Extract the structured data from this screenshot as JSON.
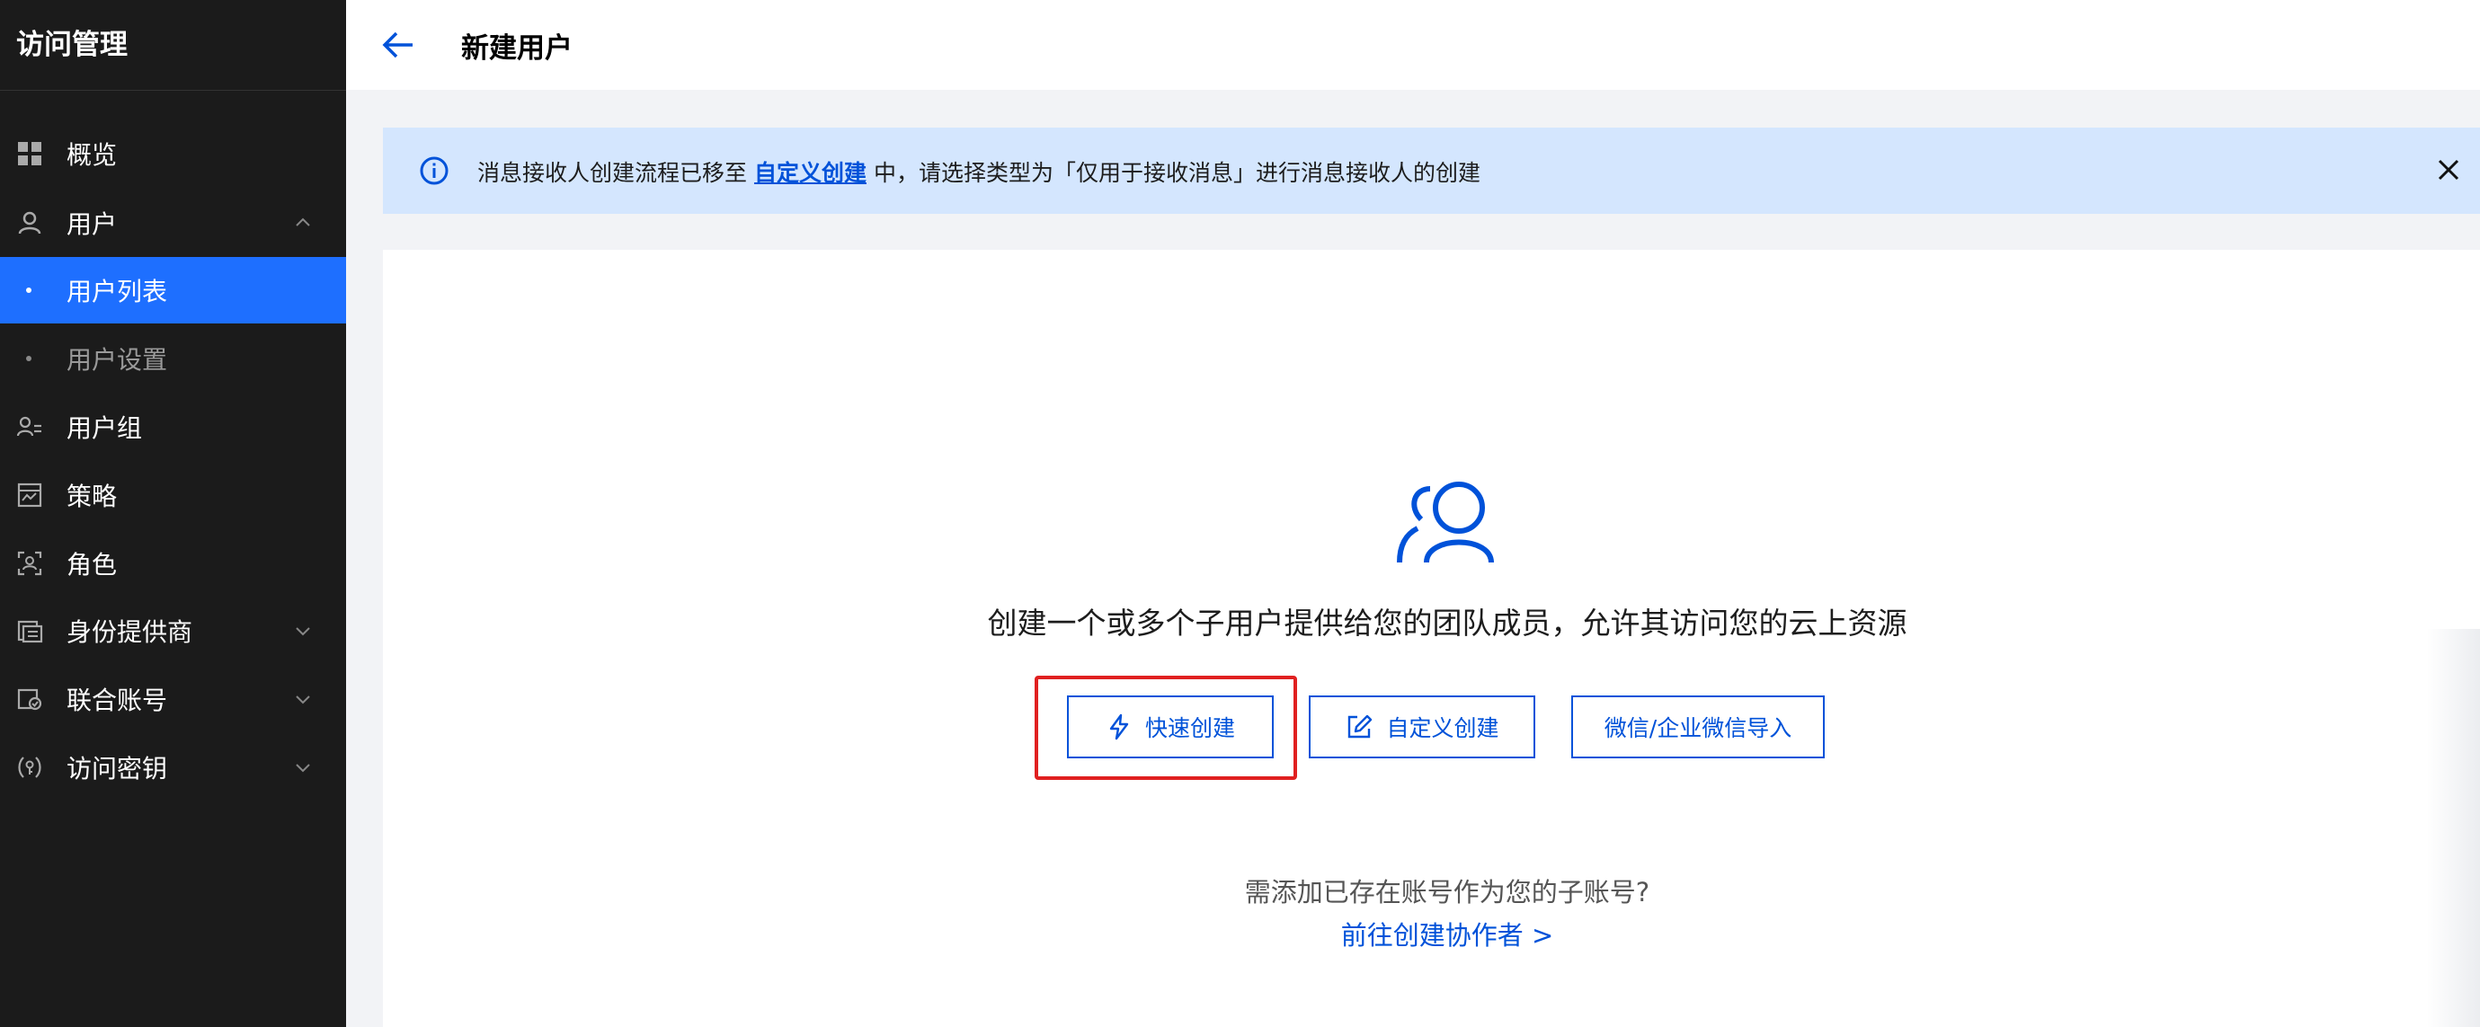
{
  "sidebar": {
    "title": "访问管理",
    "items": [
      {
        "label": "概览"
      },
      {
        "label": "用户"
      },
      {
        "label": "用户列表"
      },
      {
        "label": "用户设置"
      },
      {
        "label": "用户组"
      },
      {
        "label": "策略"
      },
      {
        "label": "角色"
      },
      {
        "label": "身份提供商"
      },
      {
        "label": "联合账号"
      },
      {
        "label": "访问密钥"
      }
    ]
  },
  "header": {
    "title": "新建用户"
  },
  "banner": {
    "text_before": "消息接收人创建流程已移至",
    "link": "自定义创建",
    "text_after": "中，请选择类型为「仅用于接收消息」进行消息接收人的创建"
  },
  "main": {
    "headline": "创建一个或多个子用户提供给您的团队成员，允许其访问您的云上资源",
    "buttons": {
      "quick": "快速创建",
      "custom": "自定义创建",
      "wechat": "微信/企业微信导入"
    },
    "question": "需添加已存在账号作为您的子账号?",
    "collab_link": "前往创建协作者 >"
  },
  "colors": {
    "accent": "#0052d9",
    "sidebar_active": "#1e6fff",
    "highlight": "#e02020",
    "banner_bg": "#d4e6fe"
  }
}
